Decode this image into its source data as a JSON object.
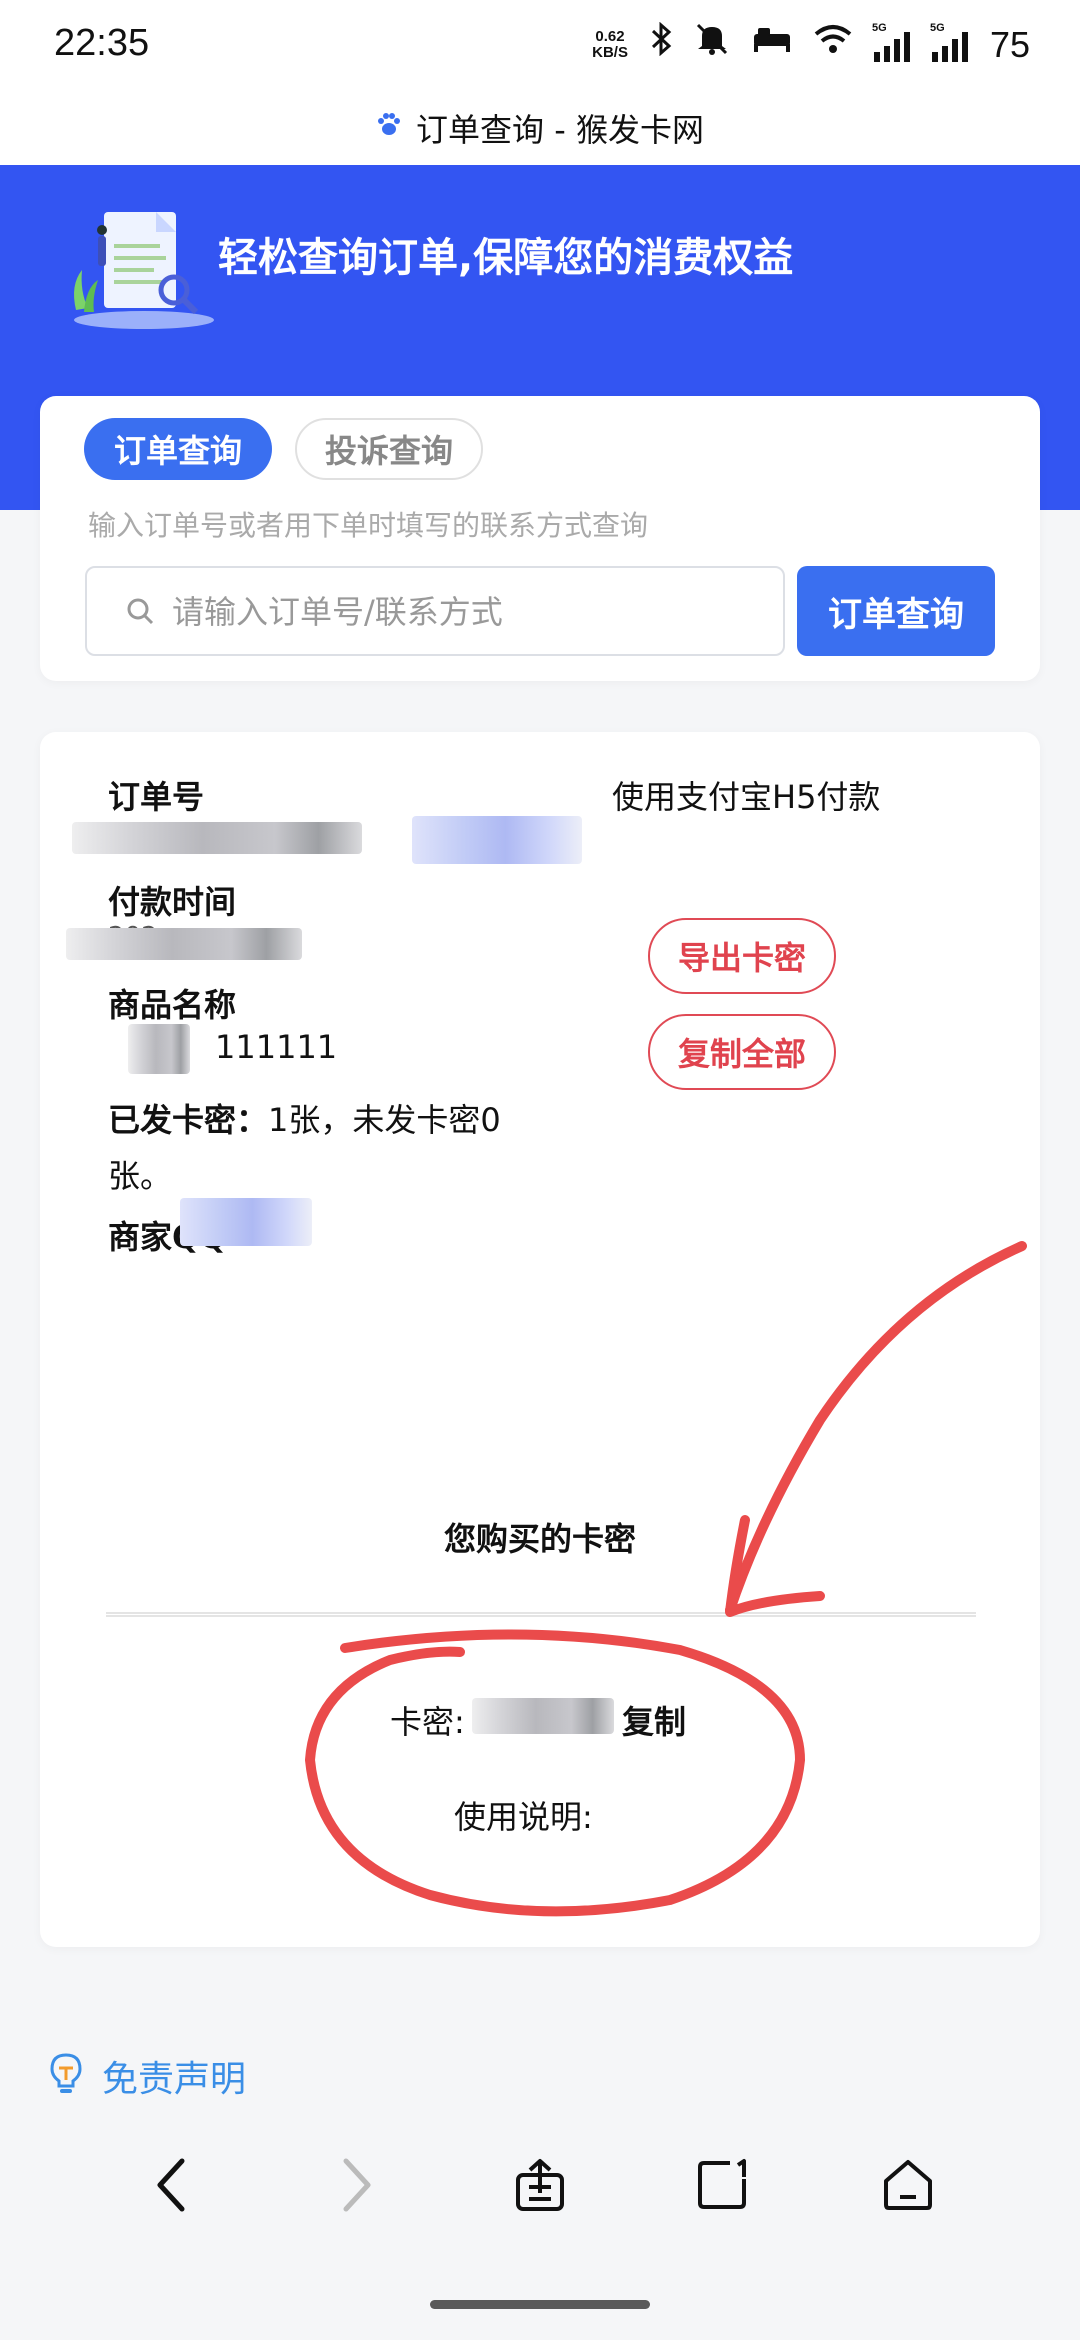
{
  "status_bar": {
    "time": "22:35",
    "net_speed_value": "0.62",
    "net_speed_unit": "KB/S",
    "signal_label_1": "5G",
    "signal_label_2": "5G",
    "battery": "75",
    "icons": [
      "bluetooth-icon",
      "mute-icon",
      "sleep-mode-icon",
      "wifi-icon",
      "signal-icon",
      "signal-icon"
    ]
  },
  "browser": {
    "page_title": "订单查询 - 猴发卡网"
  },
  "banner": {
    "slogan": "轻松查询订单,保障您的消费权益",
    "background_color": "#3355f2"
  },
  "search": {
    "tabs": [
      {
        "label": "订单查询",
        "active": true
      },
      {
        "label": "投诉查询",
        "active": false
      }
    ],
    "hint": "输入订单号或者用下单时填写的联系方式查询",
    "placeholder": "请输入订单号/联系方式",
    "value": "",
    "button_label": "订单查询"
  },
  "order": {
    "order_no_label": "订单号",
    "payment_method": "使用支付宝H5付款",
    "payment_time_label": "付款时间",
    "payment_time_partial": "202",
    "product_label": "商品名称",
    "product_name_suffix": "111111",
    "issued_label": "已发卡密：",
    "issued_text": "1张，未发卡密0张。",
    "merchant_qq_label": "商家QQ",
    "export_button": "导出卡密",
    "copy_all_button": "复制全部",
    "section_title": "您购买的卡密",
    "card_secret_label": "卡密:",
    "copy_button": "复制",
    "usage_label": "使用说明:"
  },
  "footer": {
    "disclaimer": "免责声明"
  },
  "colors": {
    "primary": "#3a6ff0",
    "danger": "#e0434e",
    "annotation": "#ea4b4b",
    "link": "#3a8ee6"
  }
}
